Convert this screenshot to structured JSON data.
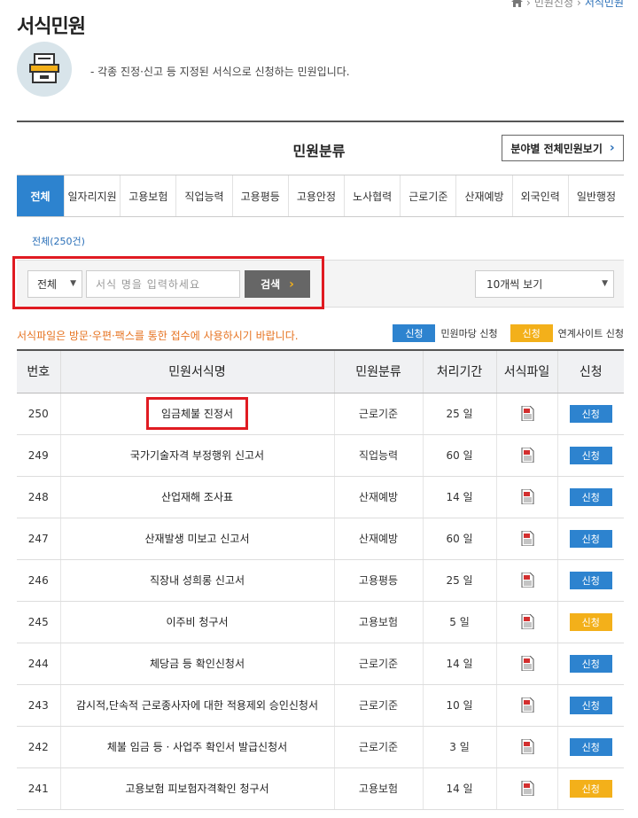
{
  "breadcrumb": {
    "items": [
      "민원신청",
      "서식민원"
    ]
  },
  "page": {
    "title": "서식민원",
    "intro": "- 각종 진정·신고 등 지정된 서식으로 신청하는 민원입니다."
  },
  "category": {
    "title": "민원분류",
    "all_button": "분야별 전체민원보기",
    "tabs": [
      "전체",
      "일자리지원",
      "고용보험",
      "직업능력",
      "고용평등",
      "고용안정",
      "노사협력",
      "근로기준",
      "산재예방",
      "외국인력",
      "일반행정"
    ],
    "count_label": "전체(250건)"
  },
  "search": {
    "scope_value": "전체",
    "placeholder": "서식 명을 입력하세요",
    "button": "검색",
    "view_value": "10개씩 보기"
  },
  "notice": "서식파일은 방문·우편·팩스를 통한 접수에 사용하시기 바랍니다.",
  "legend": {
    "blue_badge": "신청",
    "blue_text": "민원마당 신청",
    "yellow_badge": "신청",
    "yellow_text": "연계사이트 신청"
  },
  "colors": {
    "accent_blue": "#2d83cf",
    "accent_yellow": "#f3b01a",
    "highlight_red": "#e01b22",
    "notice_orange": "#e67321"
  },
  "table": {
    "headers": [
      "번호",
      "민원서식명",
      "민원분류",
      "처리기간",
      "서식파일",
      "신청"
    ],
    "rows": [
      {
        "no": "250",
        "name": "임금체불 진정서",
        "category": "근로기준",
        "period": "25 일",
        "apply": "신청",
        "type": "blue",
        "highlight": true
      },
      {
        "no": "249",
        "name": "국가기술자격 부정행위 신고서",
        "category": "직업능력",
        "period": "60 일",
        "apply": "신청",
        "type": "blue"
      },
      {
        "no": "248",
        "name": "산업재해 조사표",
        "category": "산재예방",
        "period": "14 일",
        "apply": "신청",
        "type": "blue"
      },
      {
        "no": "247",
        "name": "산재발생 미보고 신고서",
        "category": "산재예방",
        "period": "60 일",
        "apply": "신청",
        "type": "blue"
      },
      {
        "no": "246",
        "name": "직장내 성희롱 신고서",
        "category": "고용평등",
        "period": "25 일",
        "apply": "신청",
        "type": "blue"
      },
      {
        "no": "245",
        "name": "이주비 청구서",
        "category": "고용보험",
        "period": "5 일",
        "apply": "신청",
        "type": "yellow"
      },
      {
        "no": "244",
        "name": "체당금 등 확인신청서",
        "category": "근로기준",
        "period": "14 일",
        "apply": "신청",
        "type": "blue"
      },
      {
        "no": "243",
        "name": "감시적,단속적 근로종사자에 대한 적용제외 승인신청서",
        "category": "근로기준",
        "period": "10 일",
        "apply": "신청",
        "type": "blue"
      },
      {
        "no": "242",
        "name": "체불 임금 등 · 사업주 확인서 발급신청서",
        "category": "근로기준",
        "period": "3 일",
        "apply": "신청",
        "type": "blue"
      },
      {
        "no": "241",
        "name": "고용보험 피보험자격확인 청구서",
        "category": "고용보험",
        "period": "14 일",
        "apply": "신청",
        "type": "yellow"
      }
    ]
  }
}
